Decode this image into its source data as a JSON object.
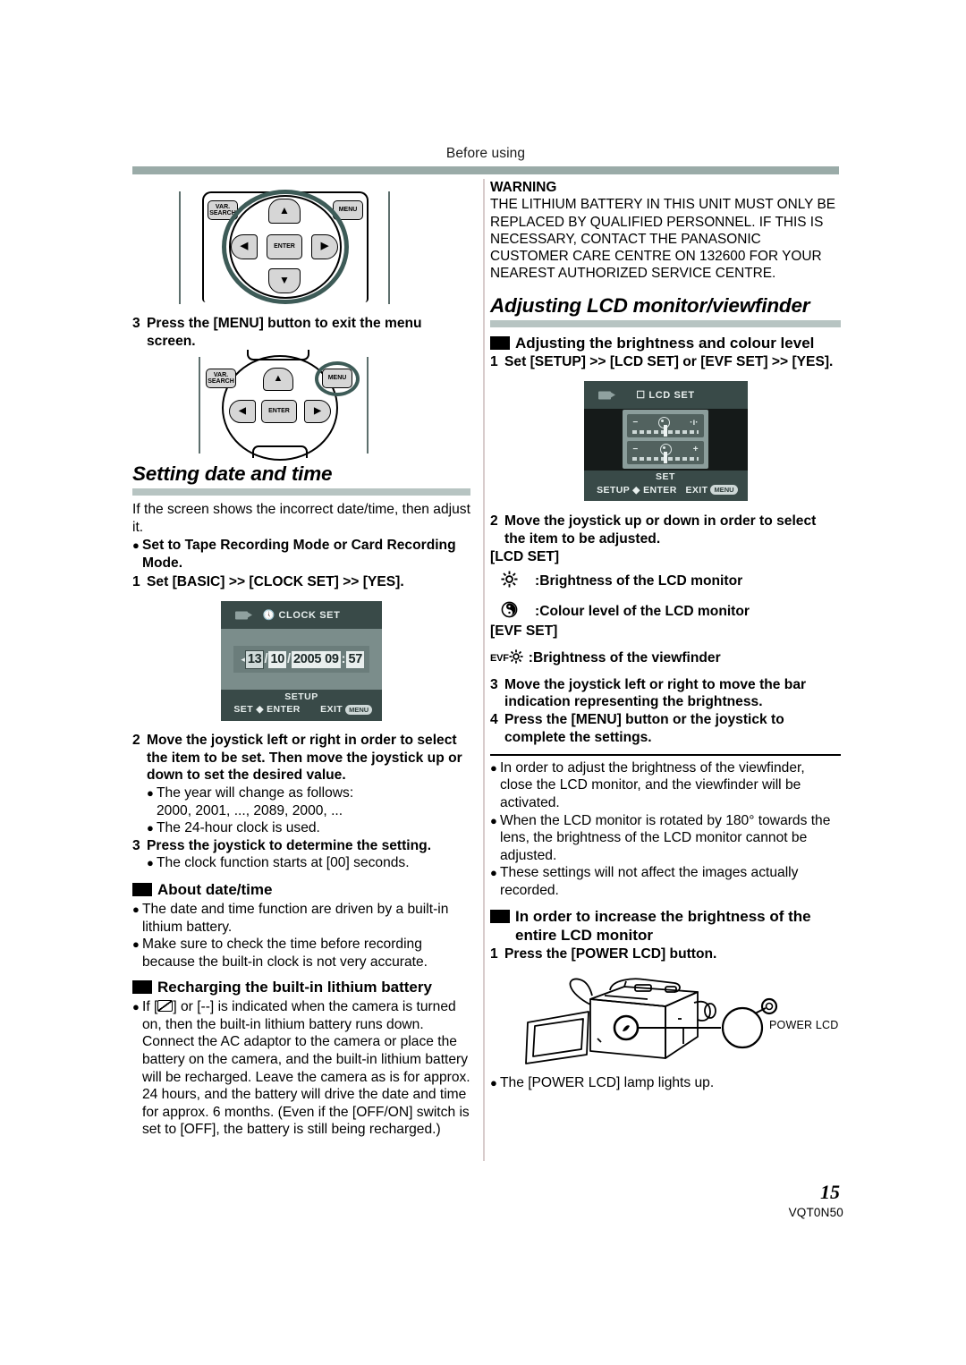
{
  "page": {
    "running_head": "Before using",
    "page_number": "15",
    "part_number": "VQT0N50"
  },
  "left_column": {
    "joystick_fig_1": {
      "caption_labels": [
        "VAR.SEARCH",
        "MENU",
        "ENTER"
      ],
      "arrow_up": "▲",
      "arrow_down": "▼",
      "arrow_left": "◀",
      "arrow_right": "▶",
      "var_label_line1": "VAR.",
      "var_label_line2": "SEARCH",
      "menu_label": "MENU",
      "enter_label": "ENTER"
    },
    "step3_menu_exit": {
      "number": "3",
      "text": "Press the [MENU] button to exit the menu screen."
    },
    "section_setting_date": {
      "title": "Setting date and time",
      "intro": "If the screen shows the incorrect date/time, then adjust it.",
      "bullet_mode": "Set to Tape Recording Mode or Card Recording Mode.",
      "step1": {
        "number": "1",
        "text": "Set [BASIC] >> [CLOCK SET] >> [YES]."
      },
      "clock_screen": {
        "title": "CLOCK SET",
        "day": "13",
        "month": "10",
        "year": "2005",
        "hour": "09",
        "minute": "57",
        "date_sep": "/",
        "time_sep": ":",
        "setup_label": "SETUP",
        "set_enter_label_left": "SET",
        "set_enter_label_right": "ENTER",
        "exit_label": "EXIT",
        "exit_pill": "MENU"
      },
      "step2": {
        "number": "2",
        "text": "Move the joystick left or right in order to select the item to be set. Then move the joystick up or down to set the desired value."
      },
      "step2_bullets": [
        "The year will change as follows:",
        "2000, 2001, ..., 2089, 2000, ...",
        "The 24-hour clock is used."
      ],
      "step3": {
        "number": "3",
        "text": "Press the joystick to determine the setting."
      },
      "step3_bullet": "The clock function starts at [00] seconds."
    },
    "about_datetime": {
      "heading": "About date/time",
      "bullets": [
        "The date and time function are driven by a built-in lithium battery.",
        "Make sure to check the time before recording because the built-in clock is not very accurate."
      ]
    },
    "recharging": {
      "heading": "Recharging the built-in lithium battery",
      "bullet_prefix": "If [",
      "bullet_middle": "] or [--] is indicated when the camera is turned on, then the built-in lithium battery runs down. Connect the AC adaptor to the camera or place the battery on the camera, and the built-in lithium battery will be recharged. Leave the camera as is for approx. 24 hours, and the battery will drive the date and time for approx. 6 months. (Even if the [OFF/ON] switch is set to [OFF], the battery is still being recharged.)"
    }
  },
  "right_column": {
    "warning": {
      "heading": "WARNING",
      "body": "THE LITHIUM BATTERY IN THIS UNIT MUST ONLY BE REPLACED BY QUALIFIED PERSONNEL. IF THIS IS NECESSARY, CONTACT THE PANASONIC CUSTOMER CARE CENTRE ON 132600 FOR YOUR NEAREST AUTHORIZED SERVICE CENTRE."
    },
    "section_adjusting": {
      "title": "Adjusting LCD monitor/viewfinder",
      "sub_heading": "Adjusting the brightness and colour level",
      "step1": {
        "number": "1",
        "text": "Set [SETUP] >> [LCD SET] or [EVF SET] >> [YES]."
      },
      "lcd_screen": {
        "title": "LCD SET",
        "minus": "−",
        "plus_brightness": "·ı·",
        "plus": "+",
        "setup_label": "SET",
        "set_enter_label_left": "SETUP",
        "set_enter_label_right": "ENTER",
        "exit_label": "EXIT",
        "exit_pill": "MENU"
      },
      "step2": {
        "number": "2",
        "text": "Move the joystick up or down in order to select the item to be adjusted."
      },
      "lcd_set_label": "[LCD SET]",
      "item_brightness_lcd": ":Brightness of the LCD monitor",
      "item_colour_lcd": ":Colour level of the LCD monitor",
      "evf_set_label": "[EVF SET]",
      "evf_prefix": "EVF",
      "item_brightness_evf": ":Brightness of the viewfinder",
      "step3": {
        "number": "3",
        "text": "Move the joystick left or right to move the bar indication representing the brightness."
      },
      "step4": {
        "number": "4",
        "text": "Press the [MENU] button or the joystick to complete the settings."
      },
      "notes": [
        "In order to adjust the brightness of the viewfinder, close the LCD monitor, and the viewfinder will be activated.",
        "When the LCD monitor is rotated by 180° towards the lens, the brightness of the LCD monitor cannot be adjusted.",
        "These settings will not affect the images actually recorded."
      ]
    },
    "increase_brightness": {
      "heading": "In order to increase the brightness of the entire LCD monitor",
      "step1": {
        "number": "1",
        "text": "Press the [POWER LCD] button."
      },
      "camera_callout_label": "POWER LCD",
      "note": "The [POWER LCD] lamp lights up."
    }
  },
  "colors": {
    "header_band": "#9aaba8",
    "rule_band": "#b7c4c2",
    "highlight_ring": "#3d5b57",
    "lcd_dark": "#394a48",
    "lcd_mid": "#7b8d8b"
  }
}
